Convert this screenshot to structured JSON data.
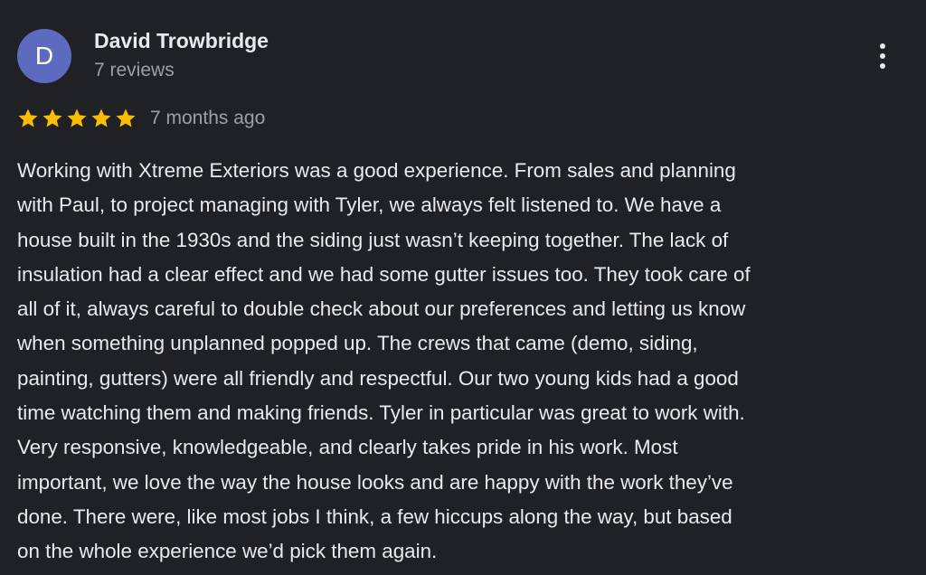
{
  "review": {
    "author": {
      "initial": "D",
      "name": "David Trowbridge",
      "reviews": "7 reviews",
      "avatar_color": "#5c6bc0"
    },
    "more_icon": "more-vert-icon",
    "rating": {
      "stars": 5,
      "max": 5,
      "star_icon": "star-icon",
      "star_color": "#fbbc04"
    },
    "date": "7 months ago",
    "text_lines": [
      "Working with Xtreme Exteriors was a good experience. From sales and planning",
      "with Paul, to project managing with Tyler, we always felt listened to. We have a",
      "house built in the 1930s and the siding just wasn’t keeping together. The lack of",
      "insulation had a clear effect and we had some gutter issues too. They took care of",
      "all of it, always careful to double check about our preferences and letting us know",
      "when something unplanned popped up. The crews that came (demo, siding,",
      "painting, gutters) were all friendly and respectful. Our two young kids had a good",
      "time watching them and making friends. Tyler in particular was great to work with.",
      "Very responsive, knowledgeable, and clearly takes pride in his work. Most",
      "important, we love the way the house looks and are happy with the work they’ve",
      "done. There were, like most jobs I think, a few hiccups along the way, but based",
      "on the whole experience we’d pick them again."
    ]
  }
}
